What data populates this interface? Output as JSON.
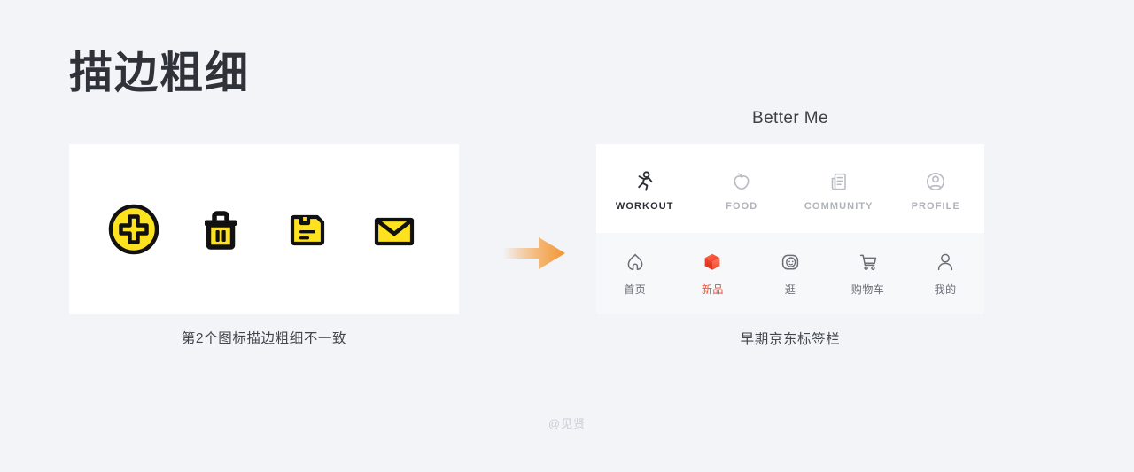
{
  "slide": {
    "title": "描边粗细",
    "background_color": "#f2f4f8",
    "watermark": "@见贤"
  },
  "left_example": {
    "caption": "第2个图标描边粗细不一致",
    "card_background": "#ffffff",
    "icon_fill_color": "#ffe21f",
    "icon_stroke_color": "#111111",
    "icons": [
      {
        "name": "plus-circle-icon",
        "label": "add"
      },
      {
        "name": "trash-icon",
        "label": "delete"
      },
      {
        "name": "save-floppy-icon",
        "label": "save"
      },
      {
        "name": "mail-envelope-icon",
        "label": "mail"
      }
    ]
  },
  "arrow": {
    "name": "right-arrow",
    "color": "#f2942f"
  },
  "right_example": {
    "app_title": "Better Me",
    "caption": "早期京东标签栏",
    "active_color_en": "#2b2e34",
    "inactive_color_en": "#b0b3ba",
    "jd_active_color": "#f2482b",
    "tabbar_top": [
      {
        "icon": "workout-runner-icon",
        "label": "WORKOUT",
        "active": true
      },
      {
        "icon": "apple-food-icon",
        "label": "FOOD",
        "active": false
      },
      {
        "icon": "document-community-icon",
        "label": "COMMUNITY",
        "active": false
      },
      {
        "icon": "user-profile-icon",
        "label": "PROFILE",
        "active": false
      }
    ],
    "tabbar_bottom": [
      {
        "icon": "home-house-icon",
        "label": "首页",
        "active": false
      },
      {
        "icon": "new-product-cube-icon",
        "label": "新品",
        "active": true
      },
      {
        "icon": "browse-face-icon",
        "label": "逛",
        "active": false
      },
      {
        "icon": "shopping-cart-icon",
        "label": "购物车",
        "active": false
      },
      {
        "icon": "profile-person-icon",
        "label": "我的",
        "active": false
      }
    ]
  }
}
